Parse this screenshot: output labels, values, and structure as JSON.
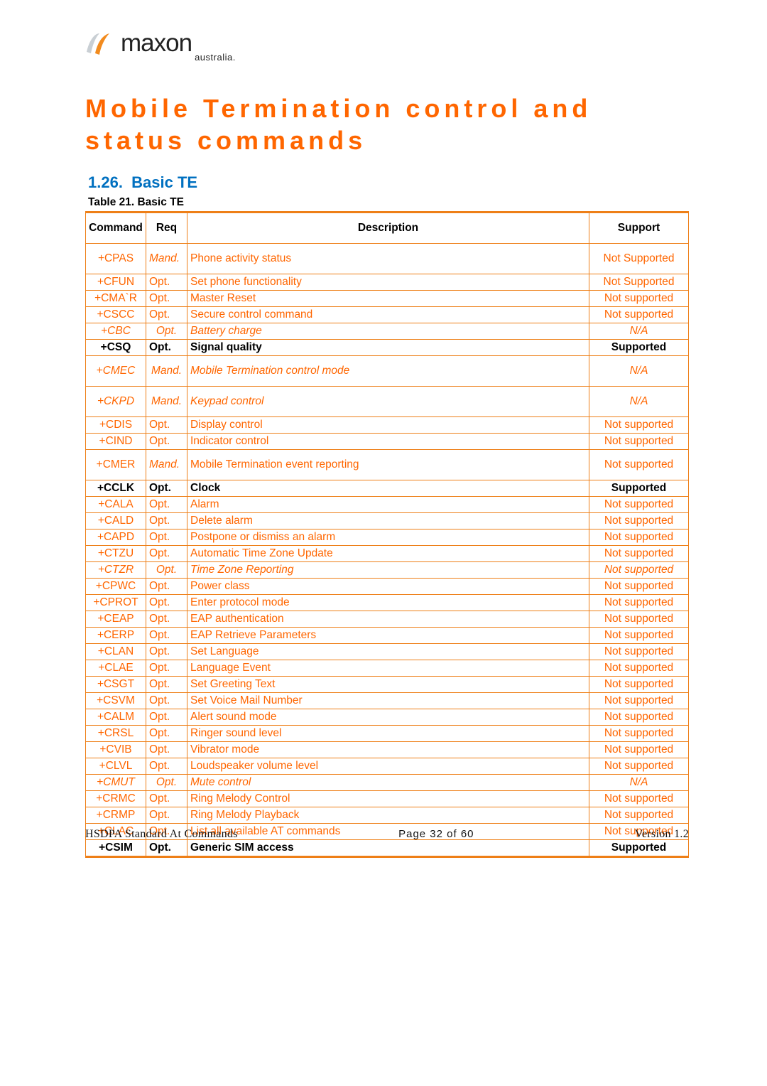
{
  "logo": {
    "name": "maxon",
    "sub": "australia."
  },
  "title": "Mobile Termination control and status commands",
  "section_no": "1.26.",
  "section_name": "Basic TE",
  "table_caption": "Table 21. Basic TE",
  "headers": {
    "cmd": "Command",
    "req": "Req",
    "desc": "Description",
    "sup": "Support"
  },
  "rows": [
    {
      "cmd": "+CPAS",
      "req": "Mand.",
      "desc": "Phone activity status",
      "sup": "Not Supported",
      "style": "mand",
      "tall": true
    },
    {
      "cmd": "+CFUN",
      "req": "Opt.",
      "desc": "Set phone functionality",
      "sup": "Not Supported"
    },
    {
      "cmd": "+CMA`R",
      "req": "Opt.",
      "desc": "Master Reset",
      "sup": "Not supported"
    },
    {
      "cmd": "+CSCC",
      "req": "Opt.",
      "desc": "Secure control command",
      "sup": "Not supported"
    },
    {
      "cmd": "+CBC",
      "req": "Opt.",
      "desc": "Battery charge",
      "sup": "N/A",
      "style": "na"
    },
    {
      "cmd": "+CSQ",
      "req": "Opt.",
      "desc": "Signal quality",
      "sup": "Supported",
      "style": "strong"
    },
    {
      "cmd": "+CMEC",
      "req": "Mand.",
      "desc": "Mobile Termination control mode",
      "sup": "N/A",
      "style": "na mand",
      "tall": true
    },
    {
      "cmd": "+CKPD",
      "req": "Mand.",
      "desc": "Keypad control",
      "sup": "N/A",
      "style": "na mand",
      "tall": true
    },
    {
      "cmd": "+CDIS",
      "req": "Opt.",
      "desc": "Display control",
      "sup": "Not supported"
    },
    {
      "cmd": "+CIND",
      "req": "Opt.",
      "desc": "Indicator control",
      "sup": "Not supported"
    },
    {
      "cmd": "+CMER",
      "req": "Mand.",
      "desc": "Mobile Termination event reporting",
      "sup": "Not supported",
      "style": "mand",
      "tall": true
    },
    {
      "cmd": "+CCLK",
      "req": "Opt.",
      "desc": "Clock",
      "sup": "Supported",
      "style": "strong"
    },
    {
      "cmd": "+CALA",
      "req": "Opt.",
      "desc": "Alarm",
      "sup": "Not supported"
    },
    {
      "cmd": "+CALD",
      "req": "Opt.",
      "desc": "Delete alarm",
      "sup": "Not supported"
    },
    {
      "cmd": "+CAPD",
      "req": "Opt.",
      "desc": "Postpone or dismiss an alarm",
      "sup": "Not supported"
    },
    {
      "cmd": "+CTZU",
      "req": "Opt.",
      "desc": "Automatic Time Zone Update",
      "sup": "Not supported"
    },
    {
      "cmd": "+CTZR",
      "req": "Opt.",
      "desc": "Time Zone Reporting",
      "sup": "Not supported",
      "style": "na"
    },
    {
      "cmd": "+CPWC",
      "req": "Opt.",
      "desc": "Power class",
      "sup": "Not supported"
    },
    {
      "cmd": "+CPROT",
      "req": "Opt.",
      "desc": "Enter protocol mode",
      "sup": "Not supported"
    },
    {
      "cmd": "+CEAP",
      "req": "Opt.",
      "desc": "EAP authentication",
      "sup": "Not supported"
    },
    {
      "cmd": "+CERP",
      "req": "Opt.",
      "desc": "EAP Retrieve Parameters",
      "sup": "Not supported"
    },
    {
      "cmd": "+CLAN",
      "req": "Opt.",
      "desc": "Set Language",
      "sup": "Not supported"
    },
    {
      "cmd": "+CLAE",
      "req": "Opt.",
      "desc": "Language Event",
      "sup": "Not supported"
    },
    {
      "cmd": "+CSGT",
      "req": "Opt.",
      "desc": "Set Greeting Text",
      "sup": "Not supported"
    },
    {
      "cmd": "+CSVM",
      "req": "Opt.",
      "desc": "Set Voice Mail Number",
      "sup": "Not supported"
    },
    {
      "cmd": "+CALM",
      "req": "Opt.",
      "desc": "Alert sound mode",
      "sup": "Not supported"
    },
    {
      "cmd": "+CRSL",
      "req": "Opt.",
      "desc": "Ringer sound level",
      "sup": "Not supported"
    },
    {
      "cmd": "+CVIB",
      "req": "Opt.",
      "desc": "Vibrator mode",
      "sup": "Not supported"
    },
    {
      "cmd": "+CLVL",
      "req": "Opt.",
      "desc": "Loudspeaker volume level",
      "sup": "Not supported"
    },
    {
      "cmd": "+CMUT",
      "req": "Opt.",
      "desc": "Mute control",
      "sup": "N/A",
      "style": "na"
    },
    {
      "cmd": "+CRMC",
      "req": "Opt.",
      "desc": "Ring Melody Control",
      "sup": "Not supported"
    },
    {
      "cmd": "+CRMP",
      "req": "Opt.",
      "desc": "Ring Melody Playback",
      "sup": "Not supported"
    },
    {
      "cmd": "+CLAC",
      "req": "Opt.",
      "desc": "List all available AT commands",
      "sup": "Not supported"
    },
    {
      "cmd": "+CSIM",
      "req": "Opt.",
      "desc": "Generic SIM access",
      "sup": "Supported",
      "style": "strong"
    }
  ],
  "footer": {
    "left": "HSDPA Standard At Commands",
    "center": "Page 32 of 60",
    "right": "Version 1.2"
  }
}
